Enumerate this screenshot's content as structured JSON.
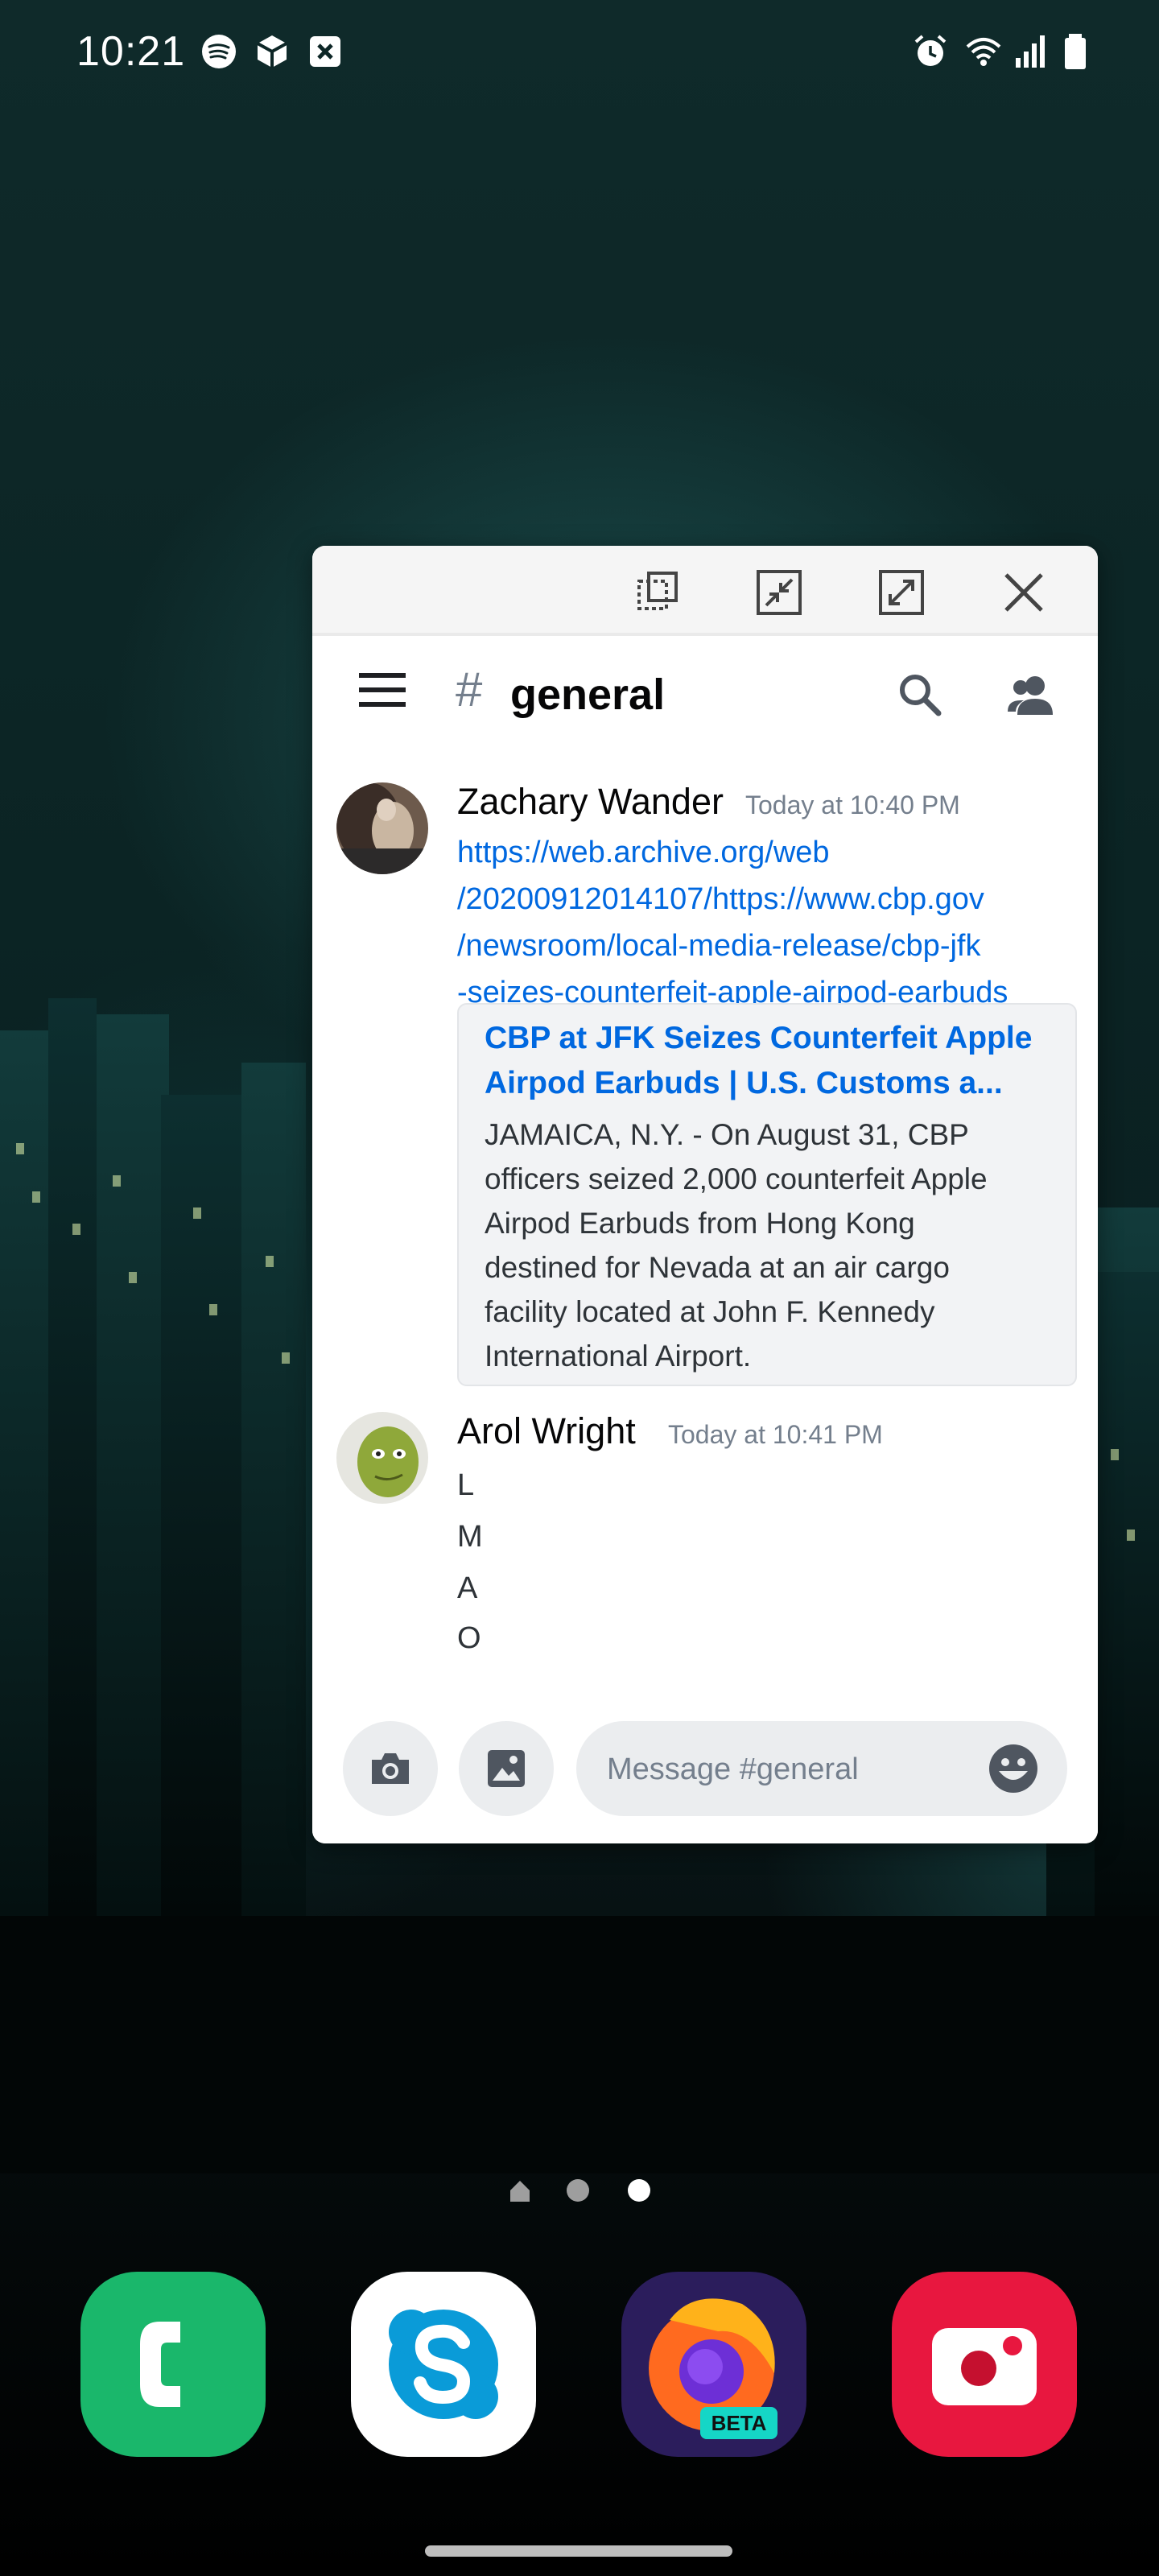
{
  "status_bar": {
    "time": "10:21",
    "left_icons": [
      "spotify-icon",
      "box-icon",
      "close-box-icon"
    ],
    "right_icons": [
      "alarm-icon",
      "wifi-icon",
      "signal-icon",
      "battery-icon"
    ]
  },
  "popup": {
    "controls": [
      "split-screen-icon",
      "minimize-icon",
      "maximize-icon",
      "close-icon"
    ],
    "channel": {
      "hash": "#",
      "name": "general"
    },
    "messages": [
      {
        "author": "Zachary Wander",
        "timestamp": "Today at 10:40 PM",
        "link_lines": [
          "https://web.archive.org/web",
          "/20200912014107/https://www.cbp.gov",
          "/newsroom/local-media-release/cbp-jfk",
          "-seizes-counterfeit-apple-airpod-earbuds"
        ],
        "embed": {
          "title_lines": [
            "CBP at JFK Seizes Counterfeit Apple",
            "Airpod Earbuds | U.S. Customs a..."
          ],
          "description_lines": [
            "JAMAICA, N.Y. - On August 31, CBP",
            "officers seized 2,000 counterfeit Apple",
            "Airpod Earbuds from Hong Kong",
            "destined for Nevada at an air cargo",
            "facility located at John F. Kennedy",
            "International Airport."
          ]
        }
      },
      {
        "author": "Arol Wright",
        "timestamp": "Today at 10:41 PM",
        "lines": [
          "L",
          "M",
          "A",
          "O"
        ]
      }
    ],
    "input": {
      "placeholder": "Message #general",
      "value": ""
    }
  },
  "pager": {
    "pages": 3,
    "current": 3
  },
  "dock": [
    {
      "name": "phone",
      "color": "#1ab76b"
    },
    {
      "name": "skype",
      "color": "#ffffff"
    },
    {
      "name": "firefox-beta",
      "color": "#2b1d5c",
      "badge": "BETA"
    },
    {
      "name": "screen-recorder",
      "color": "#e8173f"
    }
  ]
}
